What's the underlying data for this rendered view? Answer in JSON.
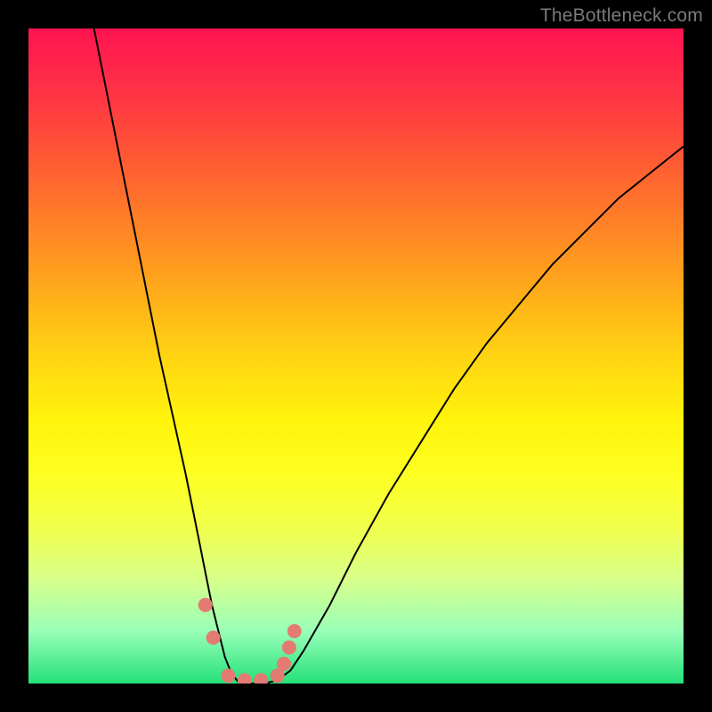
{
  "watermark": "TheBottleneck.com",
  "chart_data": {
    "type": "line",
    "title": "",
    "xlabel": "",
    "ylabel": "",
    "xlim": [
      0,
      100
    ],
    "ylim": [
      0,
      100
    ],
    "series": [
      {
        "name": "curve",
        "x": [
          10,
          12,
          14,
          16,
          18,
          20,
          22,
          24,
          26,
          27,
          28,
          29,
          30,
          31,
          32,
          33,
          34,
          36,
          38,
          40,
          42,
          46,
          50,
          55,
          60,
          65,
          70,
          75,
          80,
          85,
          90,
          95,
          100
        ],
        "y": [
          100,
          90,
          80,
          70,
          60,
          50,
          41,
          32,
          22,
          17,
          12,
          8,
          4,
          1.5,
          0.3,
          0,
          0,
          0,
          0.5,
          2,
          5,
          12,
          20,
          29,
          37,
          45,
          52,
          58,
          64,
          69,
          74,
          78,
          82
        ]
      },
      {
        "name": "markers",
        "x": [
          27.0,
          28.2,
          30.5,
          33.0,
          35.5,
          38.0,
          39.0,
          39.8,
          40.6
        ],
        "y": [
          12,
          7,
          1.2,
          0.5,
          0.5,
          1.2,
          3,
          5.5,
          8
        ]
      }
    ],
    "marker_color": "#e47b73",
    "curve_color": "#000000"
  }
}
